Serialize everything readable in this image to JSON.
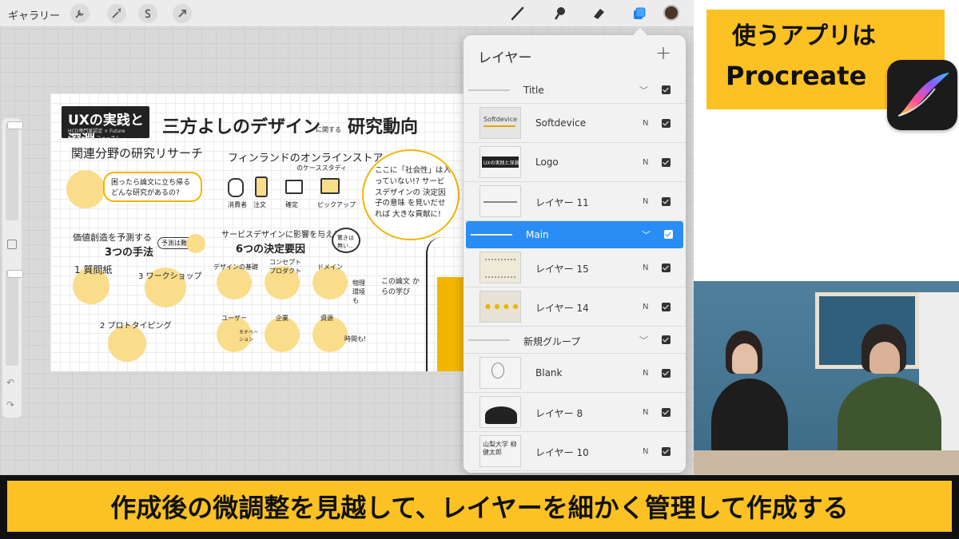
{
  "topbar": {
    "gallery_label": "ギャラリー",
    "left_tools": [
      "wrench-icon",
      "magic-wand-icon",
      "selection-icon",
      "transform-arrow-icon"
    ],
    "right_tools": [
      "brush-icon",
      "smudge-icon",
      "eraser-icon",
      "layers-icon"
    ],
    "active_tool": "layers-icon",
    "current_color": "#4a3526"
  },
  "canvas": {
    "badge_title": "UXの実践と深淵",
    "badge_sub": "HCD専門家認定 × Future Experience フォーラム",
    "main_title": "三方よしのデザイン",
    "title_small": "に関する",
    "title_right": "研究動向",
    "sec1": "関連分野の研究リサーチ",
    "bubble1": "困ったら論文に立ち帰る どんな研究があるの?",
    "sec2": "フィンランドのオンラインストア",
    "sec2_sub": "のケーススタディ",
    "flow": [
      "消費者",
      "注文",
      "確定",
      "ピックアップ"
    ],
    "bubble2": "ここに「社会性」は入っていない!? サービスデザインの 決定因子の意味 を見いだせれば 大きな貢献に!",
    "sec3a": "価値創造を予測する",
    "sec3b": "3つの手法",
    "sec3_note": "予測は難しい",
    "methods": [
      "1 質問紙",
      "3 ワークショップ",
      "2 プロトタイピング"
    ],
    "sec4a": "サービスデザインに影響を与える",
    "sec4b": "6つの決定要因",
    "sec4_note": "驚きは 無い…",
    "factors": [
      "デザインの基礎",
      "コンセプト プロダクト",
      "ドメイン",
      "物理 環境も",
      "ユーザー",
      "モチベーション",
      "企業",
      "資源",
      "時間も!"
    ],
    "paper_note": "この論文 からの学び"
  },
  "layers_panel": {
    "title": "レイヤー",
    "add_label": "+",
    "rows": [
      {
        "type": "group",
        "name": "Title",
        "selected": false
      },
      {
        "type": "layer",
        "name": "Softdevice",
        "blend": "N",
        "thumb": "Softdevice"
      },
      {
        "type": "layer",
        "name": "Logo",
        "blend": "N",
        "thumb": "UXの実践と深淵"
      },
      {
        "type": "layer",
        "name": "レイヤー 11",
        "blend": "N",
        "thumb": ""
      },
      {
        "type": "group",
        "name": "Main",
        "selected": true
      },
      {
        "type": "layer",
        "name": "レイヤー 15",
        "blend": "N",
        "thumb": ""
      },
      {
        "type": "layer",
        "name": "レイヤー 14",
        "blend": "N",
        "thumb": ""
      },
      {
        "type": "group",
        "name": "新規グループ",
        "selected": false
      },
      {
        "type": "layer",
        "name": "Blank",
        "blend": "N",
        "thumb": ""
      },
      {
        "type": "layer",
        "name": "レイヤー 8",
        "blend": "N",
        "thumb": ""
      },
      {
        "type": "layer",
        "name": "レイヤー 10",
        "blend": "N",
        "thumb": "山梨大学 柳 健太郎"
      }
    ]
  },
  "promo": {
    "line1": "使うアプリは",
    "line2": "Procreate"
  },
  "subtitle": {
    "text": "作成後の微調整を見越して、レイヤーを細かく管理して作成する"
  },
  "colors": {
    "accent_yellow": "#fcc223",
    "selection_blue": "#2a8df5"
  }
}
